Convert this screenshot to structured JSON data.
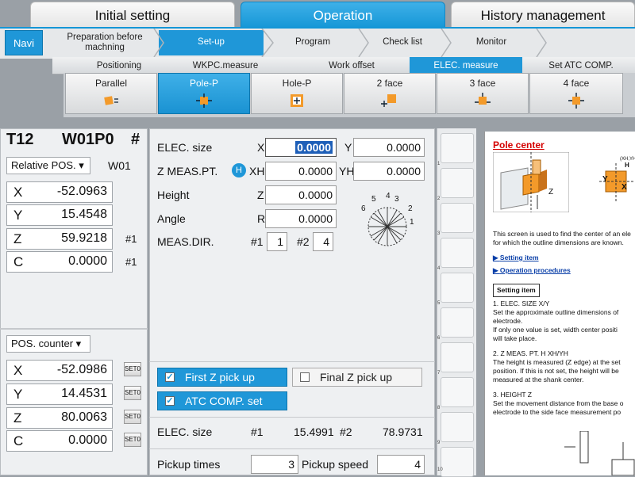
{
  "main_tabs": [
    {
      "label": "Initial setting",
      "active": false
    },
    {
      "label": "Operation",
      "active": true
    },
    {
      "label": "History management",
      "active": false
    }
  ],
  "navi": {
    "label": "Navi"
  },
  "steps": [
    {
      "label": "Preparation before machning",
      "active": false
    },
    {
      "label": "Set-up",
      "active": true
    },
    {
      "label": "Program",
      "active": false
    },
    {
      "label": "Check list",
      "active": false
    },
    {
      "label": "Monitor",
      "active": false
    }
  ],
  "sub_tabs": [
    {
      "label": "Positioning",
      "active": false
    },
    {
      "label": "WKPC.measure",
      "active": false
    },
    {
      "label": "Work offset",
      "active": false
    },
    {
      "label": "ELEC. measure",
      "active": true
    },
    {
      "label": "Set ATC COMP.",
      "active": false
    }
  ],
  "mode_buttons": [
    {
      "label": "Parallel",
      "active": false,
      "icon": "parallel-icon"
    },
    {
      "label": "Pole-P",
      "active": true,
      "icon": "pole-p-icon"
    },
    {
      "label": "Hole-P",
      "active": false,
      "icon": "hole-p-icon"
    },
    {
      "label": "2 face",
      "active": false,
      "icon": "two-face-icon"
    },
    {
      "label": "3 face",
      "active": false,
      "icon": "three-face-icon"
    },
    {
      "label": "4 face",
      "active": false,
      "icon": "four-face-icon"
    }
  ],
  "left": {
    "tool": "T12",
    "work": "W01P0",
    "hash": "#",
    "relative_dropdown": "Relative POS.",
    "relative_code": "W01",
    "relative": [
      {
        "axis": "X",
        "value": "-52.0963",
        "side": ""
      },
      {
        "axis": "Y",
        "value": "15.4548",
        "side": ""
      },
      {
        "axis": "Z",
        "value": "59.9218",
        "side": "#1"
      },
      {
        "axis": "C",
        "value": "0.0000",
        "side": "#1"
      }
    ],
    "counter_dropdown": "POS. counter",
    "counter": [
      {
        "axis": "X",
        "value": "-52.0986",
        "set": "SET0"
      },
      {
        "axis": "Y",
        "value": "14.4531",
        "set": "SET0"
      },
      {
        "axis": "Z",
        "value": "80.0063",
        "set": "SET0"
      },
      {
        "axis": "C",
        "value": "0.0000",
        "set": "SET0"
      }
    ]
  },
  "center": {
    "elec_size_label": "ELEC. size",
    "x_label": "X",
    "x_value": "0.0000",
    "y_label": "Y",
    "y_value": "0.0000",
    "zmeas_label": "Z MEAS.PT.",
    "h_badge": "H",
    "xh_label": "XH",
    "xh_value": "0.0000",
    "yh_label": "YH",
    "yh_value": "0.0000",
    "height_label": "Height",
    "height_axis": "Z",
    "height_value": "0.0000",
    "angle_label": "Angle",
    "angle_axis": "R",
    "angle_value": "0.0000",
    "measdir_label": "MEAS.DIR.",
    "dir1_label": "#1",
    "dir1_value": "1",
    "dir2_label": "#2",
    "dir2_value": "4",
    "dial_numbers": [
      "1",
      "2",
      "3",
      "4",
      "5",
      "6"
    ],
    "first_z_pick": "First Z pick up",
    "final_z_pick": "Final Z pick up",
    "atc_comp_set": "ATC COMP. set",
    "result_label": "ELEC. size",
    "r1_label": "#1",
    "r1_value": "15.4991",
    "r2_label": "#2",
    "r2_value": "78.9731",
    "pickup_times_label": "Pickup times",
    "pickup_times_value": "3",
    "pickup_speed_label": "Pickup speed",
    "pickup_speed_value": "4"
  },
  "ruler_numbers": [
    "1",
    "2",
    "3",
    "4",
    "5",
    "6",
    "7",
    "8",
    "9",
    "10"
  ],
  "doc": {
    "title": "Pole center",
    "fig_label_z": "Z",
    "fig_label_xh": "(XH,YH)",
    "fig_label_h": "H",
    "fig_label_y": "Y",
    "fig_label_x": "X",
    "intro1": "This screen is used to find the center of an ele",
    "intro2": "for which the outline dimensions are known.",
    "link1": "Setting item",
    "link2": "Operation procedures",
    "section": "Setting item",
    "items": [
      "1.  ELEC. SIZE X/Y",
      "     Set the approximate outline dimensions of",
      "     electrode.",
      "     If only one value is set, width center positi",
      "     will take place.",
      "",
      "2.  Z MEAS. PT. H XH/YH",
      "     The height is measured (Z edge) at the set",
      "     position. If this is not set, the height will be",
      "     measured at the shank center.",
      "",
      "3.  HEIGHT Z",
      "     Set the movement distance from the base o",
      "     electrode to the side face measurement po"
    ]
  },
  "colors": {
    "accent": "#1f97d8",
    "icon_orange": "#f39a2a"
  }
}
